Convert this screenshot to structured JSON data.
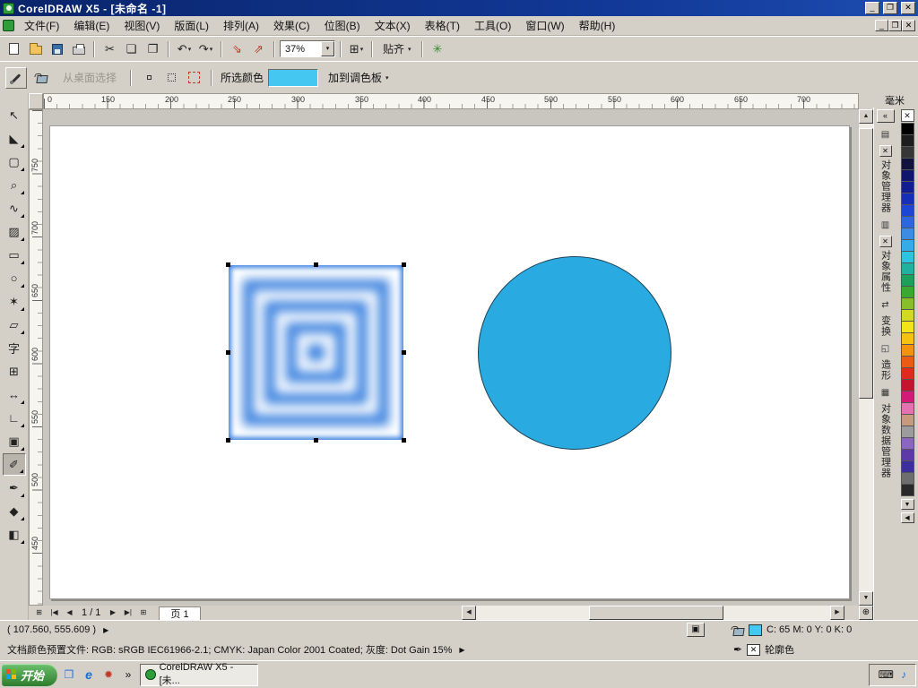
{
  "colors": {
    "chrome": "#d4d0c8",
    "titlebar": "#0a246a",
    "canvas_bg": "#c9c6bf",
    "page": "#ffffff",
    "circle_fill": "#29abe2",
    "square_blue": "#3b82e0",
    "selected_color": "#44c8f1",
    "status_fill": "#44c8f1",
    "ruler_bg": "#f7f5f0"
  },
  "window": {
    "title": "CorelDRAW X5 - [未命名 -1]",
    "controls": {
      "minimize": "_",
      "restore": "❐",
      "close": "✕"
    }
  },
  "menu": {
    "items": [
      "文件(F)",
      "编辑(E)",
      "视图(V)",
      "版面(L)",
      "排列(A)",
      "效果(C)",
      "位图(B)",
      "文本(X)",
      "表格(T)",
      "工具(O)",
      "窗口(W)",
      "帮助(H)"
    ]
  },
  "toolbar": {
    "zoom_value": "37%",
    "snap_label": "贴齐",
    "caret": "▾",
    "glyphs": {
      "cut": "✂",
      "copy": "❏",
      "paste": "❐",
      "undo": "↶",
      "redo": "↷",
      "import": "⇘",
      "export": "⇗",
      "launcher": "⊞",
      "welcome": "✳"
    }
  },
  "propbar": {
    "from_desktop_label": "从桌面选择",
    "selected_color_label": "所选颜色",
    "add_to_palette_label": "加到调色板",
    "caret": "▾"
  },
  "rulers": {
    "units": "毫米",
    "h_labels": [
      "0",
      "150",
      "200",
      "250",
      "300",
      "350",
      "400",
      "450",
      "500",
      "550",
      "600",
      "650",
      "700"
    ],
    "v_labels": [
      "750",
      "700",
      "650",
      "600",
      "550",
      "500",
      "450"
    ]
  },
  "toolbox": {
    "tools": [
      {
        "name": "pick",
        "glyph": "↖"
      },
      {
        "name": "shape",
        "glyph": "◣"
      },
      {
        "name": "crop",
        "glyph": "▢"
      },
      {
        "name": "zoom",
        "glyph": "⌕"
      },
      {
        "name": "freehand",
        "glyph": "∿"
      },
      {
        "name": "smart-fill",
        "glyph": "▨"
      },
      {
        "name": "rectangle",
        "glyph": "▭"
      },
      {
        "name": "ellipse",
        "glyph": "○"
      },
      {
        "name": "polygon",
        "glyph": "✶"
      },
      {
        "name": "basic-shapes",
        "glyph": "▱"
      },
      {
        "name": "text",
        "glyph": "字"
      },
      {
        "name": "table",
        "glyph": "⊞"
      },
      {
        "name": "dimension",
        "glyph": "↔"
      },
      {
        "name": "connector",
        "glyph": "∟"
      },
      {
        "name": "blend",
        "glyph": "▣"
      },
      {
        "name": "color-eyedropper",
        "glyph": "✐"
      },
      {
        "name": "outline-pen",
        "glyph": "✒"
      },
      {
        "name": "fill",
        "glyph": "◆"
      },
      {
        "name": "interactive-fill",
        "glyph": "◧"
      }
    ]
  },
  "shapes": {
    "square": {
      "ring_color": "#3b82e0",
      "gap_color": "#ffffff"
    },
    "circle": {
      "fill": "#29abe2",
      "stroke": "#1d4354"
    }
  },
  "dockers": {
    "collapse": "«",
    "tabs": [
      {
        "icon": "▤",
        "label": "对象管理器",
        "close": "✕"
      },
      {
        "icon": "▥",
        "label": "对象属性",
        "close": "✕"
      },
      {
        "icon": "⇄",
        "label": "变换"
      },
      {
        "icon": "◱",
        "label": "造形"
      },
      {
        "icon": "▦",
        "label": "对象数据管理器"
      }
    ]
  },
  "palette": {
    "none_glyph": "✕",
    "scroll_down": "▼",
    "expand": "◀",
    "colors": [
      "#000000",
      "#1d1d1d",
      "#363636",
      "#121240",
      "#10166b",
      "#101e8f",
      "#1430b8",
      "#1c47d4",
      "#2e66e0",
      "#3c8ce4",
      "#35ace8",
      "#2cc4e0",
      "#20b2a0",
      "#1da05c",
      "#3aa832",
      "#86bf2a",
      "#d2d922",
      "#f2e418",
      "#f6c211",
      "#f2930d",
      "#ea5c14",
      "#e02a1e",
      "#c41430",
      "#d41a78",
      "#e272b2",
      "#c79a7e",
      "#9c9c9c",
      "#8a66c0",
      "#5e3aa6",
      "#3d2e9e",
      "#6e6e6e",
      "#2a2a2a"
    ]
  },
  "pagebar": {
    "add_page": "⊞",
    "first": "|◀",
    "prev": "◀",
    "info": "1 / 1",
    "next": "▶",
    "last": "▶|",
    "tab": "页 1"
  },
  "scroll": {
    "up": "▲",
    "down": "▼",
    "left": "◀",
    "right": "▶",
    "pan": "⊕"
  },
  "statusbar": {
    "coords": "( 107.560, 555.609 )",
    "more": "▶",
    "profile": "文档颜色预置文件: RGB: sRGB IEC61966-2.1; CMYK: Japan Color 2001 Coated; 灰度: Dot Gain 15%",
    "fill_text": "C: 65 M: 0 Y: 0 K: 0",
    "outline_label": "轮廓色",
    "outline_none": "✕",
    "pen_glyph": "✒"
  },
  "taskbar": {
    "start_label": "开始",
    "task_label": "CorelDRAW X5 - [未...",
    "overflow": "»",
    "ie_glyph": "e",
    "quick_glyphs": {
      "desktop": "❒",
      "corel": "✹"
    },
    "tray": [
      "⌨",
      "♪"
    ]
  }
}
